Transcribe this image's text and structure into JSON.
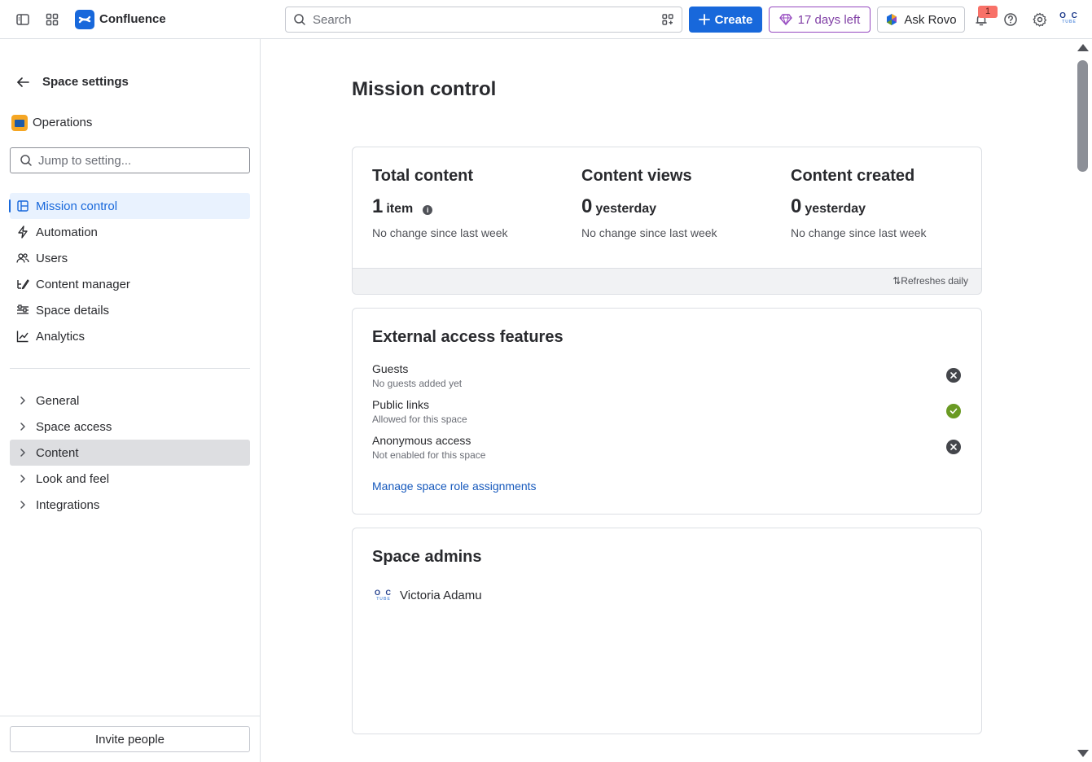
{
  "topbar": {
    "app_name": "Confluence",
    "search_placeholder": "Search",
    "create_label": "Create",
    "trial_label": "17 days left",
    "rovo_label": "Ask Rovo",
    "notification_count": "1",
    "avatar_initials": "O C",
    "avatar_sub": "TUBE"
  },
  "sidebar": {
    "title": "Space settings",
    "space_name": "Operations",
    "jump_placeholder": "Jump to setting...",
    "items": [
      {
        "label": "Mission control",
        "icon": "layout-icon"
      },
      {
        "label": "Automation",
        "icon": "lightning-icon"
      },
      {
        "label": "Users",
        "icon": "people-icon"
      },
      {
        "label": "Content manager",
        "icon": "content-icon"
      },
      {
        "label": "Space details",
        "icon": "sliders-icon"
      },
      {
        "label": "Analytics",
        "icon": "chart-icon"
      }
    ],
    "groups": [
      {
        "label": "General"
      },
      {
        "label": "Space access"
      },
      {
        "label": "Content"
      },
      {
        "label": "Look and feel"
      },
      {
        "label": "Integrations"
      }
    ],
    "invite_label": "Invite people"
  },
  "main": {
    "title": "Mission control",
    "stats": [
      {
        "heading": "Total content",
        "value": "1",
        "unit": "item",
        "change": "No change since last week"
      },
      {
        "heading": "Content views",
        "value": "0",
        "unit": "yesterday",
        "change": "No change since last week"
      },
      {
        "heading": "Content created",
        "value": "0",
        "unit": "yesterday",
        "change": "No change since last week"
      }
    ],
    "refresh_label": "Refreshes daily",
    "external": {
      "heading": "External access features",
      "features": [
        {
          "label": "Guests",
          "status": "No guests added yet",
          "enabled": false
        },
        {
          "label": "Public links",
          "status": "Allowed for this space",
          "enabled": true
        },
        {
          "label": "Anonymous access",
          "status": "Not enabled for this space",
          "enabled": false
        }
      ],
      "manage_link": "Manage space role assignments"
    },
    "admins": {
      "heading": "Space admins",
      "list": [
        {
          "name": "Victoria Adamu",
          "initials": "O C",
          "sub": "TUBE"
        }
      ]
    }
  },
  "colors": {
    "brand": "#1868db",
    "trial": "#964ac0",
    "enabled": "#6a9a23",
    "disabled": "#44464b"
  }
}
